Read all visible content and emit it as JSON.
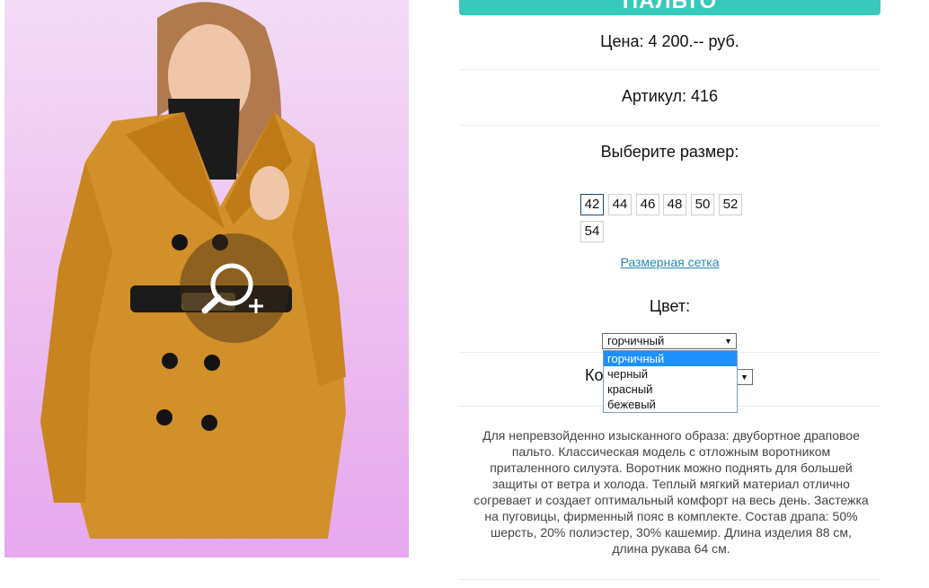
{
  "product": {
    "title": "ПАЛЬТО",
    "price": "Цена: 4 200.-- руб.",
    "article": "Артикул: 416",
    "size_label": "Выберите размер:",
    "sizes": [
      "42",
      "44",
      "46",
      "48",
      "50",
      "52",
      "54"
    ],
    "selected_size": "42",
    "size_chart_link": "Размерная сетка",
    "color_label": "Цвет:",
    "color_selected": "горчичный",
    "color_options": [
      "горчичный",
      "черный",
      "красный",
      "бежевый"
    ],
    "quantity_label_visible": "Ко",
    "description": "Для непревзойденно изысканного образа: двубортное драповое пальто. Классическая модель с отложным воротником приталенного силуэта. Воротник можно поднять для большей защиты от ветра и холода. Теплый мягкий материал отлично согревает и создает оптимальный комфорт на весь день. Застежка на пуговицы, фирменный пояс в комплекте. Состав драпа: 50% шерсть, 20% полиэстер, 30% кашемир. Длина изделия 88 см, длина рукава 64 см."
  },
  "icons": {
    "zoom": "zoom-in-icon",
    "dropdown_arrow": "triangle-down"
  },
  "colors": {
    "accent": "#38c9bd",
    "link": "#2a8ab8",
    "selected_option": "#1e90ff",
    "photo_background": "#eec3f0",
    "coat": "#d2902a"
  }
}
